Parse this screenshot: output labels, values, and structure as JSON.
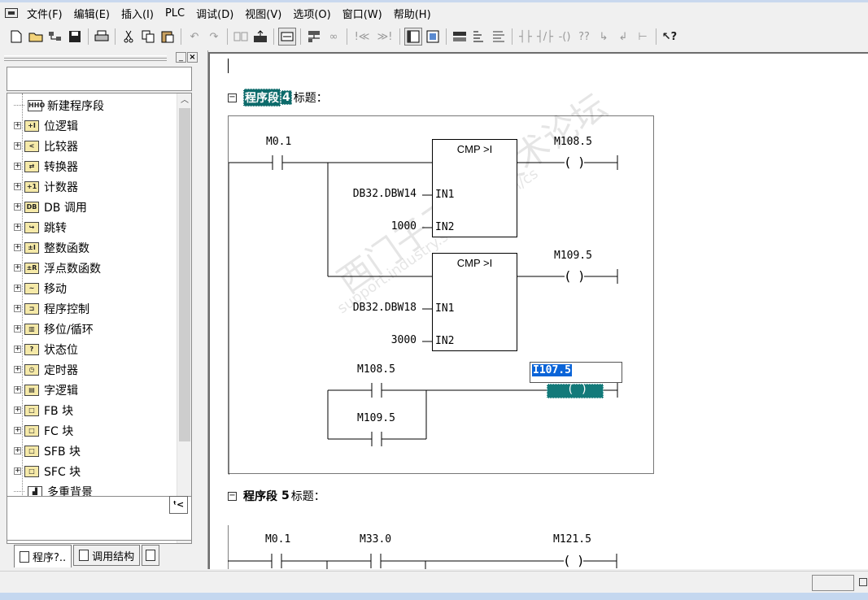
{
  "menu": [
    "文件(F)",
    "编辑(E)",
    "插入(I)",
    "PLC",
    "调试(D)",
    "视图(V)",
    "选项(O)",
    "窗口(W)",
    "帮助(H)"
  ],
  "toolbar_icons": [
    "new-file-icon",
    "open-folder-icon",
    "access-online-icon",
    "save-icon",
    "print-icon",
    "cut-icon",
    "copy-icon",
    "paste-icon",
    "undo-icon",
    "redo-icon",
    "load-icon",
    "upload-icon",
    "overview-icon",
    "network-icon",
    "monitor-icon",
    "insert-network-icon",
    "details-icon",
    "symbol-icon",
    "open-contact-icon",
    "closed-contact-icon",
    "coil-icon",
    "empty-box-icon",
    "branch-open-icon",
    "branch-close-icon",
    "help-icon"
  ],
  "toolbar_text": {
    "prev": "!≪",
    "next": "≫!",
    "contact_no": "┤├",
    "contact_nc": "┤/├",
    "coil": "-()",
    "box": "??",
    "branch_open": "↳",
    "branch_close": "↲",
    "connection": "⊢"
  },
  "tree": {
    "items": [
      {
        "label": "新建程序段",
        "icon": "HHO",
        "expandable": false
      },
      {
        "label": "位逻辑",
        "icon": "+I",
        "expandable": true
      },
      {
        "label": "比较器",
        "icon": "<",
        "expandable": true
      },
      {
        "label": "转换器",
        "icon": "⇄",
        "expandable": true
      },
      {
        "label": "计数器",
        "icon": "+1",
        "expandable": true
      },
      {
        "label": "DB 调用",
        "icon": "DB",
        "expandable": true
      },
      {
        "label": "跳转",
        "icon": "↪",
        "expandable": true
      },
      {
        "label": "整数函数",
        "icon": "±I",
        "expandable": true
      },
      {
        "label": "浮点数函数",
        "icon": "±R",
        "expandable": true
      },
      {
        "label": "移动",
        "icon": "~",
        "expandable": true
      },
      {
        "label": "程序控制",
        "icon": "⊐",
        "expandable": true
      },
      {
        "label": "移位/循环",
        "icon": "▥",
        "expandable": true
      },
      {
        "label": "状态位",
        "icon": "?",
        "expandable": true
      },
      {
        "label": "定时器",
        "icon": "◷",
        "expandable": true
      },
      {
        "label": "字逻辑",
        "icon": "▤",
        "expandable": true
      },
      {
        "label": "FB 块",
        "icon": "□",
        "expandable": true
      },
      {
        "label": "FC 块",
        "icon": "□",
        "expandable": true
      },
      {
        "label": "SFB 块",
        "icon": "□",
        "expandable": true
      },
      {
        "label": "SFC 块",
        "icon": "□",
        "expandable": true
      },
      {
        "label": "多重背景",
        "icon": "▟",
        "expandable": false
      }
    ],
    "expander_symbol": "+"
  },
  "tabs": [
    {
      "label": "程序?..",
      "active": true
    },
    {
      "label": "调用结构",
      "active": false
    }
  ],
  "sort_button": "ᵗ<",
  "editor": {
    "network4": {
      "collapse": "−",
      "word": "程序段",
      "number": "4",
      "colon": "：",
      "title_label": "标题："
    },
    "network5": {
      "collapse": "−",
      "word": "程序段",
      "number": "5",
      "colon": "：",
      "title_label": "标题："
    },
    "n4": {
      "contact_main": "M0.1",
      "cmp1": {
        "title": "CMP >I",
        "in1_label": "IN1",
        "in2_label": "IN2",
        "in1_value": "DB32.DBW14",
        "in2_value": "1000",
        "coil": "M108.5"
      },
      "cmp2": {
        "title": "CMP >I",
        "in1_label": "IN1",
        "in2_label": "IN2",
        "in1_value": "DB32.DBW18",
        "in2_value": "3000",
        "coil": "M109.5"
      },
      "branch_contact1": "M108.5",
      "branch_contact2": "M109.5",
      "edit_value": "I107.5"
    },
    "n5": {
      "contact1": "M0.1",
      "contact2": "M33.0",
      "coil": "M121.5"
    }
  },
  "watermark": {
    "line1": "西门子工业   技术论坛",
    "line2": "support.industry.siemens.com/cs"
  }
}
